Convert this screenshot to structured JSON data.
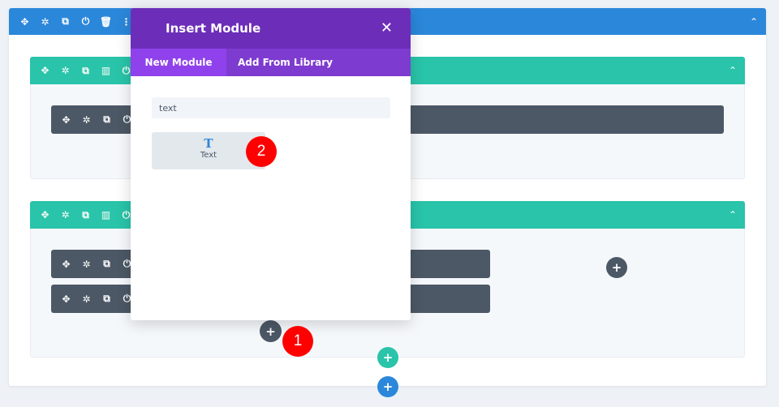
{
  "colors": {
    "section": "#2b87da",
    "row": "#29c4a9",
    "module": "#4c5866",
    "modal_header": "#6c2eb9",
    "tab_active": "#8f42ec",
    "badge": "#ff0000"
  },
  "section_toolbar": {
    "icons": [
      "move-icon",
      "gear-icon",
      "duplicate-icon",
      "power-icon",
      "trash-icon",
      "more-icon"
    ],
    "glyphs": [
      "✥",
      "✲",
      "⧉",
      "⏻",
      "🗑",
      "⋮"
    ]
  },
  "row_toolbar": {
    "glyphs": [
      "✥",
      "✲",
      "⧉",
      "▥",
      "⏻"
    ]
  },
  "module_toolbar": {
    "glyphs": [
      "✥",
      "✲",
      "⧉",
      "⏻"
    ]
  },
  "modal": {
    "title": "Insert Module",
    "close": "✕",
    "tabs": [
      {
        "label": "New Module",
        "active": true
      },
      {
        "label": "Add From Library",
        "active": false
      }
    ],
    "search_value": "text",
    "modules": [
      {
        "icon": "T",
        "label": "Text"
      }
    ]
  },
  "annotations": [
    "1",
    "2"
  ],
  "plus": "+",
  "chevron": "⌃"
}
